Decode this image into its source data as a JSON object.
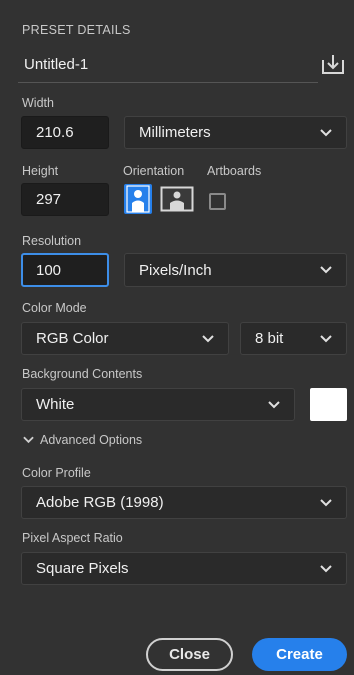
{
  "header": {
    "title": "PRESET DETAILS",
    "preset_name": "Untitled-1"
  },
  "icons": {
    "save_preset": "save-preset-icon",
    "portrait": "portrait-icon",
    "landscape": "landscape-icon",
    "chevron": "chevron-down-icon"
  },
  "width": {
    "label": "Width",
    "value": "210.6",
    "unit": "Millimeters"
  },
  "height": {
    "label": "Height",
    "value": "297"
  },
  "orientation": {
    "label": "Orientation",
    "selected": "portrait"
  },
  "artboards": {
    "label": "Artboards",
    "checked": false
  },
  "resolution": {
    "label": "Resolution",
    "value": "100",
    "unit": "Pixels/Inch"
  },
  "color_mode": {
    "label": "Color Mode",
    "mode": "RGB Color",
    "depth": "8 bit"
  },
  "background": {
    "label": "Background Contents",
    "value": "White",
    "swatch": "#ffffff"
  },
  "advanced": {
    "label": "Advanced Options"
  },
  "color_profile": {
    "label": "Color Profile",
    "value": "Adobe RGB (1998)"
  },
  "pixel_aspect": {
    "label": "Pixel Aspect Ratio",
    "value": "Square Pixels"
  },
  "buttons": {
    "close": "Close",
    "create": "Create"
  },
  "colors": {
    "accent": "#2680eb",
    "panel": "#323232",
    "field": "#1f1f1f"
  }
}
